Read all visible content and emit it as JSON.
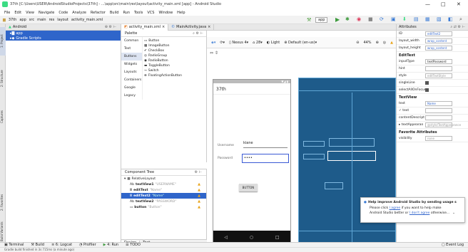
{
  "window": {
    "title": "37th [C:\\Users\\USER\\AndroidStudioProjects\\37th] - ...\\app\\src\\main\\res\\layout\\activity_main.xml [app] - Android Studio",
    "min": "—",
    "max": "□",
    "close": "✕"
  },
  "menu": [
    "File",
    "Edit",
    "View",
    "Navigate",
    "Code",
    "Analyze",
    "Refactor",
    "Build",
    "Run",
    "Tools",
    "VCS",
    "Window",
    "Help"
  ],
  "nav": [
    "37th",
    "app",
    "src",
    "main",
    "res",
    "layout",
    "activity_main.xml"
  ],
  "runconfig": "app",
  "left_tabs": [
    "1: Project",
    "2: Structure",
    "Captures",
    "2: Favorites",
    "Build Variants"
  ],
  "project": {
    "header": "Android",
    "items": [
      "app",
      "Gradle Scripts"
    ]
  },
  "tabs": [
    "activity_main.xml",
    "MainActivity.java"
  ],
  "palette": {
    "title": "Palette",
    "categories": [
      "Common",
      "Text",
      "Buttons",
      "Widgets",
      "Layouts",
      "Containers",
      "Google",
      "Legacy"
    ],
    "items": [
      "Button",
      "ImageButton",
      "CheckBox",
      "RadioGroup",
      "RadioButton",
      "ToggleButton",
      "Switch",
      "FloatingActionButton"
    ]
  },
  "tree": {
    "title": "Component Tree",
    "root": "RelativeLayout",
    "nodes": [
      {
        "name": "textView1",
        "hint": "\"USERNAME\""
      },
      {
        "name": "editText",
        "hint": "\"Name\""
      },
      {
        "name": "editText2",
        "hint": "\"Name\""
      },
      {
        "name": "textView2",
        "hint": "\"PASSWORD\""
      },
      {
        "name": "button",
        "hint": "\"Button\""
      }
    ]
  },
  "designbar": {
    "device": "Nexus 4",
    "api": "28",
    "theme": "Light",
    "locale": "Default (en-us)",
    "zoom": "44%"
  },
  "phone": {
    "title": "37th",
    "username_label": "Username",
    "username_value": "kiane",
    "password_label": "Password",
    "password_value": "••••",
    "button": "BUTTON",
    "time": "▼◢ ▮"
  },
  "attrs": {
    "title": "Attributes",
    "id_label": "ID",
    "id": "editText2",
    "lw_label": "layout_width",
    "lw": "wrap_content",
    "lh_label": "layout_height",
    "lh": "wrap_content",
    "sec1": "EditText",
    "it_label": "inputType",
    "it": "textPassword",
    "hint_label": "hint",
    "style_label": "style",
    "style": "editTextStyle",
    "sl_label": "singleLine",
    "sa_label": "selectAllOnFocus",
    "sec2": "TextView",
    "text_label": "text",
    "text": "Name",
    "text2_label": "text",
    "cd_label": "contentDescript",
    "ta_label": "textAppearan",
    "ta": "@style/TextAppearance",
    "sec3": "Favorite Attributes",
    "vis_label": "visibility",
    "vis": "none"
  },
  "design_tabs": [
    "Design",
    "Text"
  ],
  "bottom": [
    "Terminal",
    "Build",
    "6: Logcat",
    "Profiler",
    "4: Run",
    "TODO"
  ],
  "eventlog": "Event Log",
  "status": "Gradle build finished in 3s 715ms (a minute ago)",
  "notif": {
    "title": "Help improve Android Studio by sending usage s",
    "l1a": "Please click ",
    "l1link": "I agree",
    "l1b": " if you want to help make",
    "l2a": "Android Studio better or ",
    "l2link": "I don't agree",
    "l2b": " otherwise..."
  }
}
